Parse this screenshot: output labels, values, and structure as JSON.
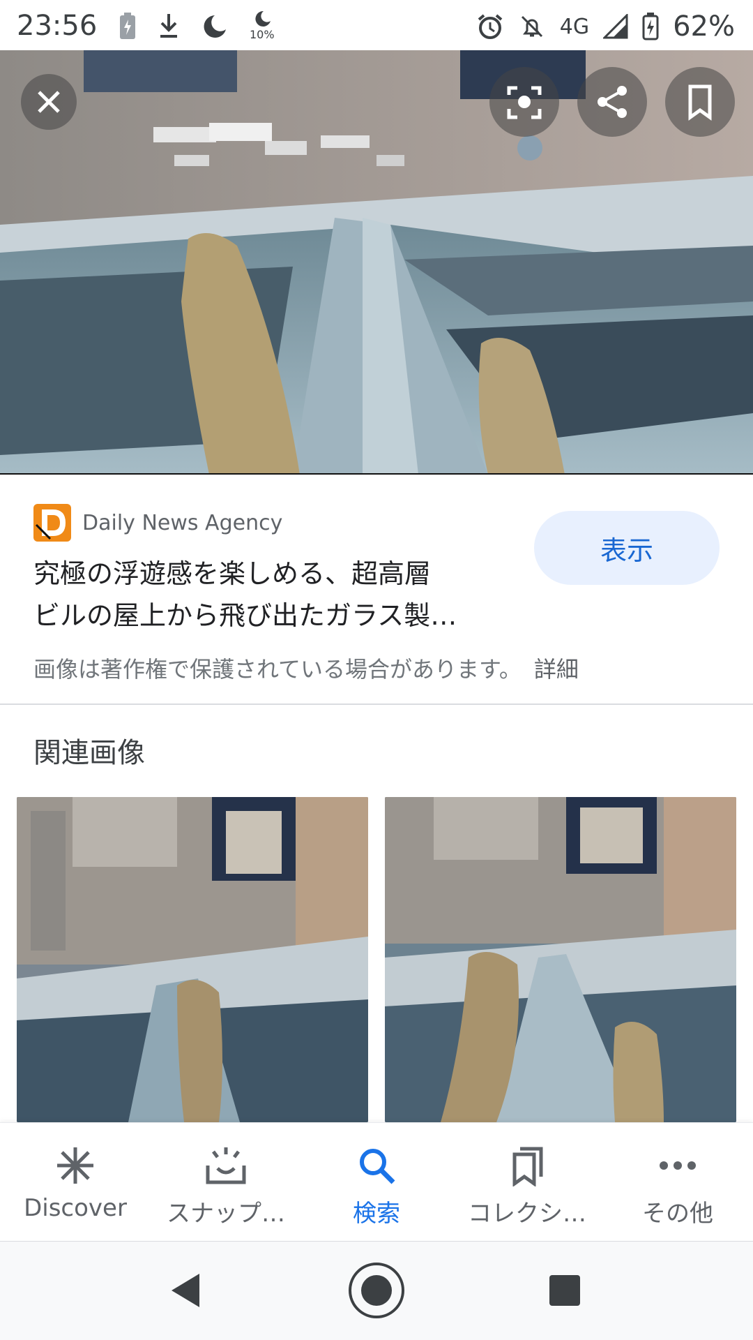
{
  "status_bar": {
    "time": "23:56",
    "network": "4G",
    "battery": "62%",
    "dnd_level": "10%"
  },
  "hero": {
    "icons": [
      "close-icon",
      "lens-icon",
      "share-icon",
      "bookmark-icon"
    ]
  },
  "result": {
    "source": "Daily News Agency",
    "title_line1": "究極の浮遊感を楽しめる、超高層",
    "title_line2": "ビルの屋上から飛び出たガラス製…",
    "view_button": "表示",
    "copyright": "画像は著作権で保護されている場合があります。",
    "detail_link": "詳細"
  },
  "related": {
    "heading": "関連画像"
  },
  "bottom_nav": {
    "items": [
      {
        "label": "Discover",
        "icon": "discover-icon",
        "active": false
      },
      {
        "label": "スナップ…",
        "icon": "snapshot-icon",
        "active": false
      },
      {
        "label": "検索",
        "icon": "search-icon",
        "active": true
      },
      {
        "label": "コレクシ…",
        "icon": "collections-icon",
        "active": false
      },
      {
        "label": "その他",
        "icon": "more-icon",
        "active": false
      }
    ]
  },
  "colors": {
    "accent": "#1a73e8",
    "button_bg": "#e8f0fe",
    "button_text": "#1967d2"
  }
}
